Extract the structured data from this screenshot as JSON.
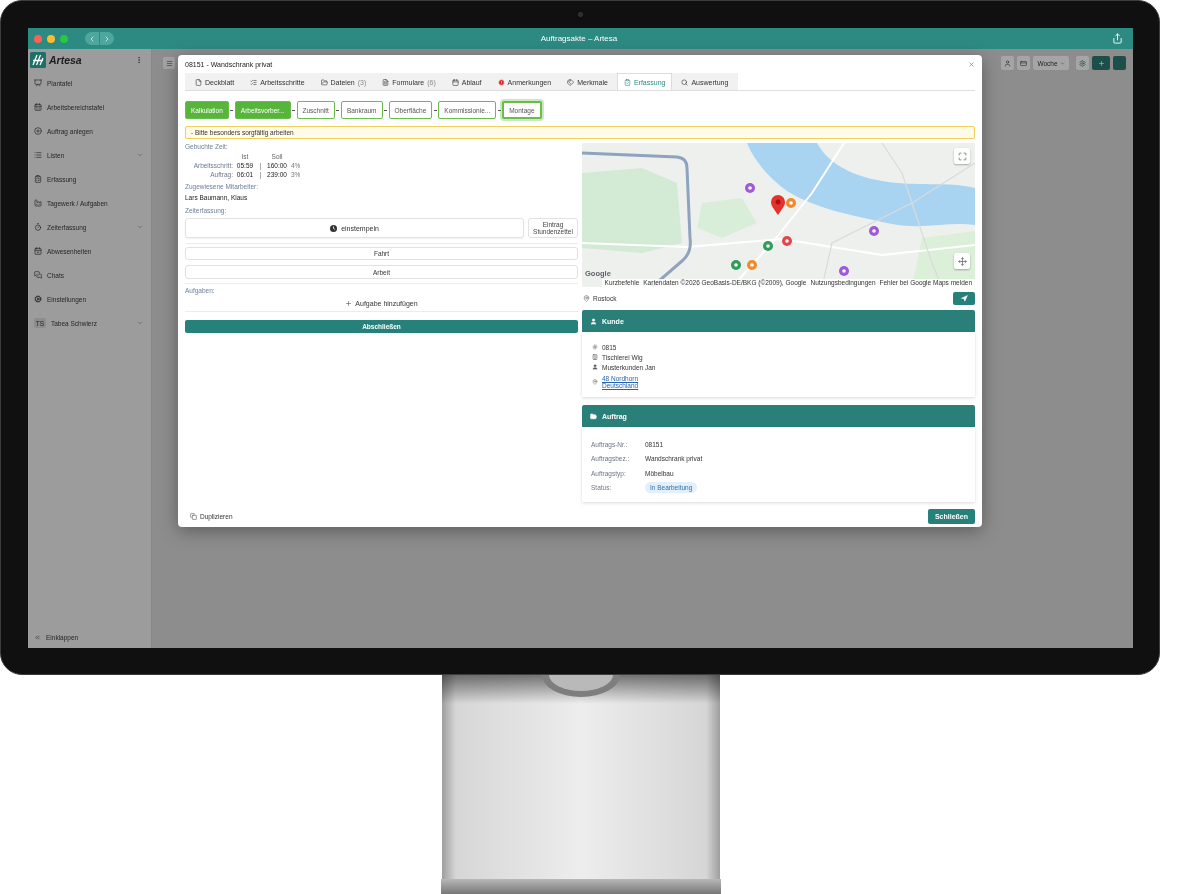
{
  "window": {
    "title": "Auftragsakte – Artesa"
  },
  "sidebar": {
    "logo": "Artesa",
    "items": [
      {
        "label": "Plantafel",
        "expandable": false
      },
      {
        "label": "Arbeitsbereichstafel",
        "expandable": false
      },
      {
        "label": "Auftrag anlegen",
        "expandable": false
      },
      {
        "label": "Listen",
        "expandable": true
      },
      {
        "label": "Erfassung",
        "expandable": false
      },
      {
        "label": "Tagewerk / Aufgaben",
        "expandable": false
      },
      {
        "label": "Zeiterfassung",
        "expandable": true
      },
      {
        "label": "Abwesenheiten",
        "expandable": false
      },
      {
        "label": "Chats",
        "expandable": false
      },
      {
        "label": "Einstellungen",
        "expandable": false
      },
      {
        "label": "Tabea Schwierz",
        "avatar": "TS",
        "expandable": true
      }
    ],
    "collapse": "Einklappen"
  },
  "toolbar": {
    "view": "Woche"
  },
  "dialog": {
    "title": "08151 - Wandschrank privat",
    "tabs": [
      {
        "label": "Deckblatt",
        "selected": false
      },
      {
        "label": "Arbeitsschritte",
        "selected": false
      },
      {
        "label": "Dateien",
        "count": "(3)",
        "selected": false
      },
      {
        "label": "Formulare",
        "count": "(6)",
        "selected": false
      },
      {
        "label": "Ablauf",
        "selected": false
      },
      {
        "label": "Anmerkungen",
        "selected": false
      },
      {
        "label": "Merkmale",
        "selected": false
      },
      {
        "label": "Erfassung",
        "selected": true
      },
      {
        "label": "Auswertung",
        "selected": false
      }
    ],
    "steps": [
      {
        "label": "Kalkulation",
        "done": true,
        "current": false
      },
      {
        "label": "Arbeitsvorber...",
        "done": true,
        "current": false
      },
      {
        "label": "Zuschnitt",
        "done": false,
        "current": false
      },
      {
        "label": "Bankraum",
        "done": false,
        "current": false
      },
      {
        "label": "Oberfläche",
        "done": false,
        "current": false
      },
      {
        "label": "Kommissionie...",
        "done": false,
        "current": false
      },
      {
        "label": "Montage",
        "done": false,
        "current": true
      }
    ],
    "notice": "- Bitte besonders sorgfältig arbeiten",
    "booked_time": {
      "label": "Gebuchte Zeit:",
      "columns": [
        "Ist",
        "Soll"
      ],
      "rows": [
        {
          "label": "Arbeitsschritt:",
          "actual": "05:59",
          "planned": "160:00",
          "percent": "4%"
        },
        {
          "label": "Auftrag:",
          "actual": "06:01",
          "planned": "239:00",
          "percent": "3%"
        }
      ]
    },
    "assigned": {
      "label": "Zugewiesene Mitarbeiter:",
      "value": "Lars Baumann, Klaus"
    },
    "time_tracking": {
      "label": "Zeiterfassung:",
      "clock_in": "einstempeln",
      "timesheet_entry": "Eintrag Stundenzettel",
      "activities": [
        "Fahrt",
        "Arbeit"
      ]
    },
    "tasks": {
      "label": "Aufgaben:",
      "add": "Aufgabe hinzufügen"
    },
    "complete": "Abschließen",
    "map": {
      "logo": "Google",
      "attribution": [
        "Kurzbefehle",
        "Kartendaten ©2026 GeoBasis-DE/BKG (©2009), Google",
        "Nutzungsbedingungen",
        "Fehler bei Google Maps melden"
      ]
    },
    "location": "Rostock",
    "customer": {
      "title": "Kunde",
      "number": "0815",
      "company": "Tischlerei Wig",
      "contact": "Musterkunden Jan",
      "address": [
        "48 Nordhorn",
        "Deutschland"
      ]
    },
    "order": {
      "title": "Auftrag",
      "fields": [
        {
          "label": "Auftrags-Nr.:",
          "value": "08151",
          "kind": "text"
        },
        {
          "label": "Auftragsbez.:",
          "value": "Wandschrank privat",
          "kind": "text"
        },
        {
          "label": "Auftragstyp:",
          "value": "Möbelbau",
          "kind": "text"
        },
        {
          "label": "Status:",
          "value": "In Bearbeitung",
          "kind": "badge"
        }
      ]
    },
    "footer": {
      "duplicate": "Duplizieren",
      "close": "Schließen"
    }
  }
}
